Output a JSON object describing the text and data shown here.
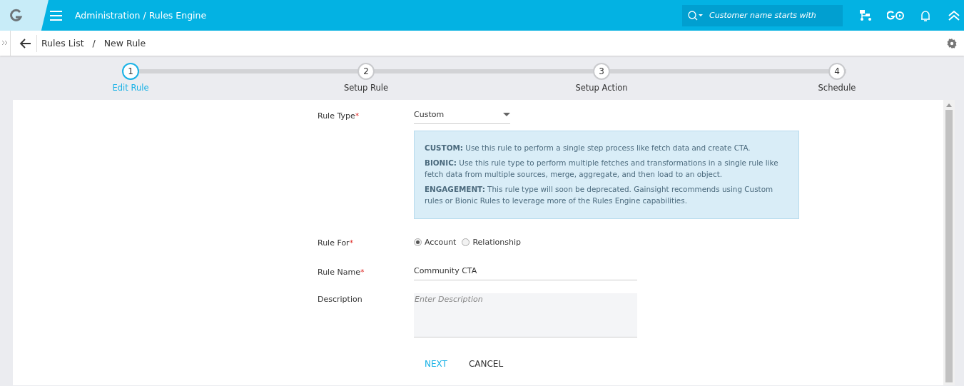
{
  "header": {
    "title": "Administration / Rules Engine",
    "search": {
      "placeholder": "Customer name starts with"
    }
  },
  "breadcrumb": {
    "items": [
      "Rules List",
      "New Rule"
    ],
    "separator": "/"
  },
  "steps": [
    {
      "number": "1",
      "label": "Edit Rule",
      "selected": true
    },
    {
      "number": "2",
      "label": "Setup Rule",
      "selected": false
    },
    {
      "number": "3",
      "label": "Setup Action",
      "selected": false
    },
    {
      "number": "4",
      "label": "Schedule",
      "selected": false
    }
  ],
  "form": {
    "rule_type": {
      "label": "Rule Type",
      "required_mark": "*",
      "value": "Custom"
    },
    "info": [
      "**CUSTOM:** Use this rule to perform a single step process like fetch data and create CTA.",
      "**BIONIC:** Use this rule type to perform multiple fetches and transformations in a single rule like fetch data from multiple sources, merge, aggregate, and then load to an object.",
      "**ENGAGEMENT:** This rule type will soon be deprecated. Gainsight recommends using Custom rules or Bionic Rules to leverage more of the Rules Engine capabilities."
    ],
    "rule_for": {
      "label": "Rule For",
      "required_mark": "*",
      "options": [
        {
          "label": "Account",
          "selected": true
        },
        {
          "label": "Relationship",
          "selected": false
        }
      ]
    },
    "rule_name": {
      "label": "Rule Name",
      "required_mark": "*",
      "value": "Community CTA"
    },
    "description": {
      "label": "Description",
      "placeholder": "Enter Description"
    },
    "buttons": [
      {
        "label": "NEXT",
        "kind": "primary"
      },
      {
        "label": "CANCEL",
        "kind": "secondary"
      }
    ]
  }
}
